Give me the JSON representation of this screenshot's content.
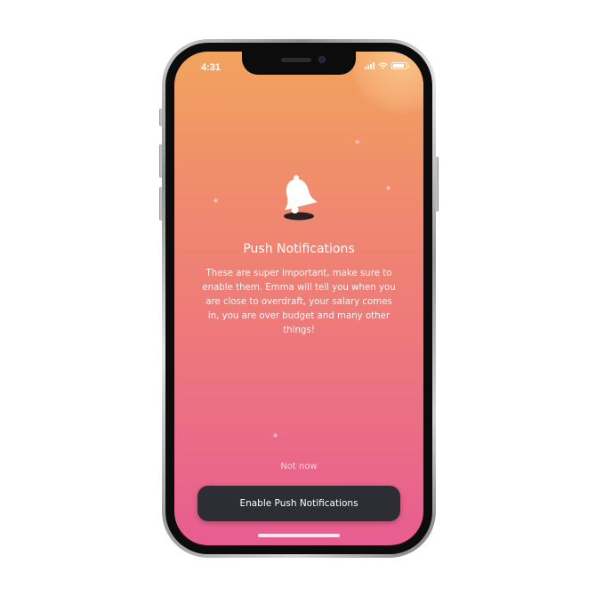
{
  "status_bar": {
    "time": "4:31"
  },
  "onboarding": {
    "icon": "bell-icon",
    "title": "Push Notifications",
    "description": "These are super important, make sure to enable them. Emma will tell you when you are close to overdraft, your salary comes in, you are over budget and many other things!",
    "secondary_action": "Not now",
    "primary_action": "Enable Push Notifications"
  },
  "colors": {
    "gradient_top": "#f2a35e",
    "gradient_bottom": "#e85d90",
    "button_background": "#2c2e34",
    "text": "#ffffff"
  }
}
